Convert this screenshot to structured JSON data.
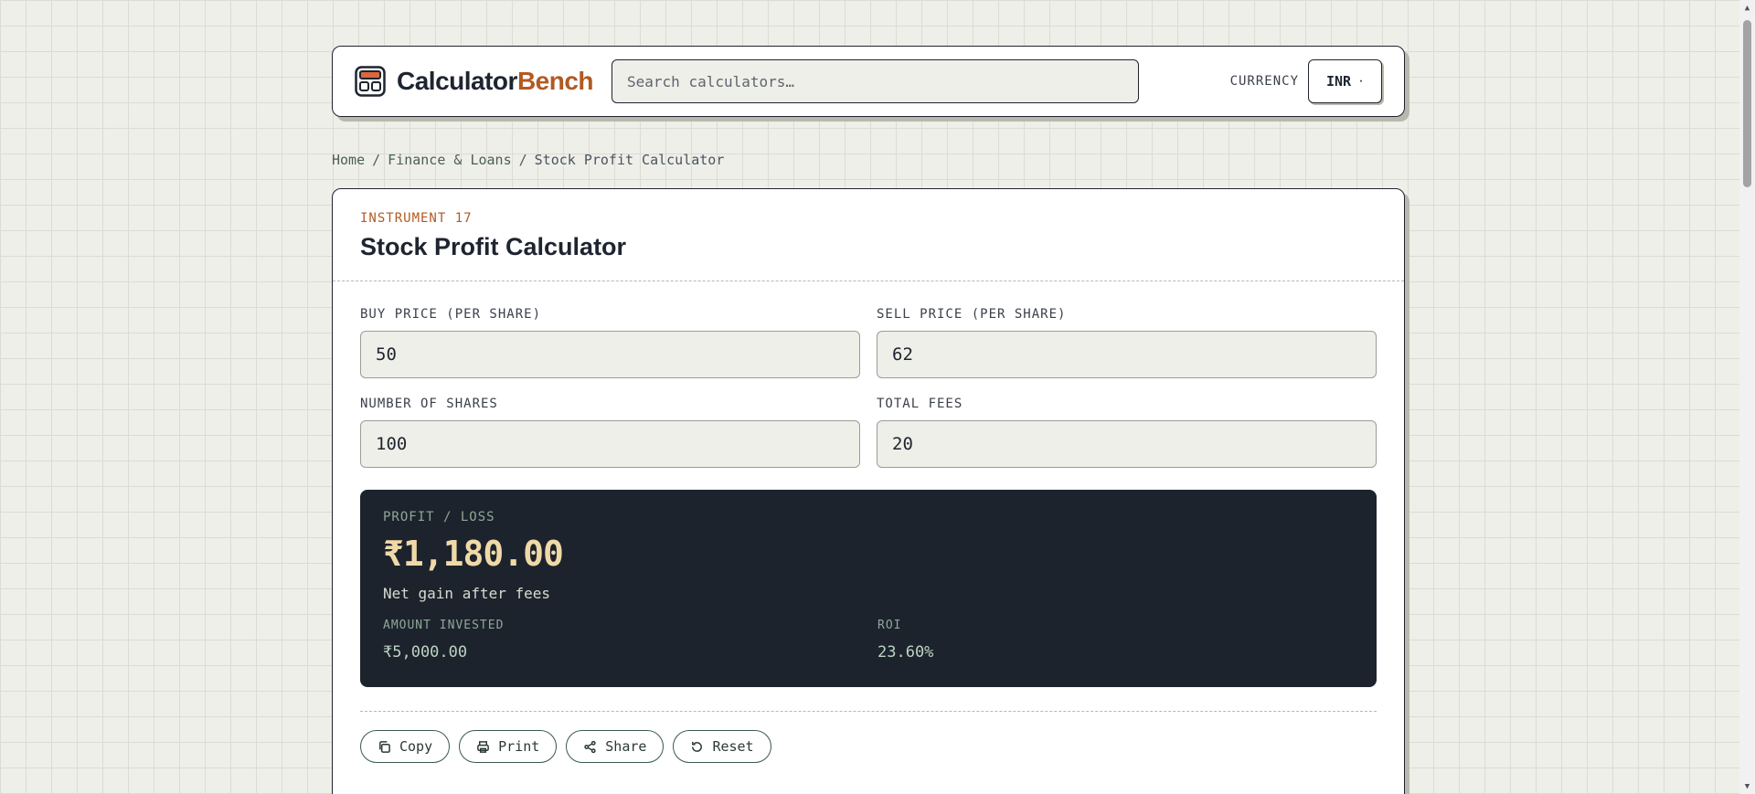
{
  "header": {
    "brand_part1": "Calculator",
    "brand_part2": "Bench",
    "logo_icon": "calculator-icon",
    "search_placeholder": "Search calculators…",
    "currency_label": "CURRENCY",
    "currency_value": "INR",
    "currency_caret": "·"
  },
  "breadcrumb": {
    "items": [
      "Home",
      "Finance & Loans",
      "Stock Profit Calculator"
    ],
    "separator": "/"
  },
  "calculator": {
    "instrument": "INSTRUMENT 17",
    "title": "Stock Profit Calculator",
    "fields": {
      "buy_label": "BUY PRICE (PER SHARE)",
      "buy_value": "50",
      "sell_label": "SELL PRICE (PER SHARE)",
      "sell_value": "62",
      "shares_label": "NUMBER OF SHARES",
      "shares_value": "100",
      "fees_label": "TOTAL FEES",
      "fees_value": "20"
    },
    "result": {
      "label": "PROFIT / LOSS",
      "value": "₹1,180.00",
      "note": "Net gain after fees",
      "invested_label": "AMOUNT INVESTED",
      "invested_value": "₹5,000.00",
      "roi_label": "ROI",
      "roi_value": "23.60%"
    },
    "actions": {
      "copy": "Copy",
      "print": "Print",
      "share": "Share",
      "reset": "Reset"
    }
  },
  "colors": {
    "accent": "#b15a22",
    "dark_panel": "#1d232d",
    "result_value": "#f0d9a8",
    "background": "#efefe9"
  }
}
